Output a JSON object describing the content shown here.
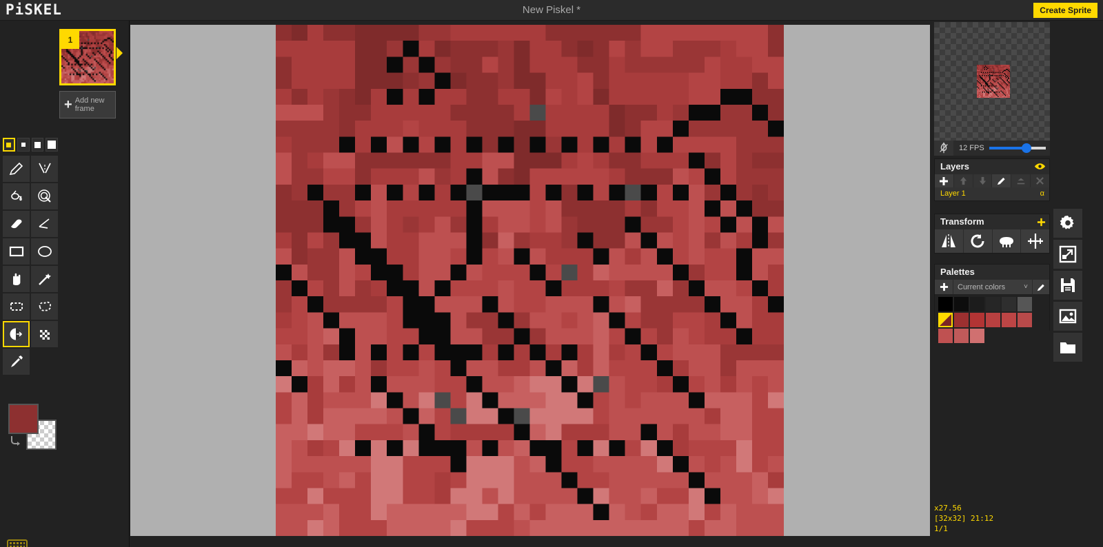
{
  "app": {
    "logo": "PiSKEL",
    "title": "New Piskel *",
    "create_sprite_label": "Create Sprite",
    "accent": "#ffd900",
    "bg": "#222222"
  },
  "frames": {
    "items": [
      {
        "number": "1",
        "selected": true
      }
    ],
    "add_frame_label_line1": "Add new",
    "add_frame_label_line2": "frame",
    "add_frame_plus": "+"
  },
  "pen_sizes": [
    {
      "name": "size-1",
      "selected": true
    },
    {
      "name": "size-2",
      "selected": false
    },
    {
      "name": "size-3",
      "selected": false
    },
    {
      "name": "size-4",
      "selected": false
    }
  ],
  "tools": [
    {
      "name": "pen-tool",
      "icon": "pencil-icon",
      "selected": false
    },
    {
      "name": "vertical-mirror-pen-tool",
      "icon": "mirror-pen-icon",
      "selected": false
    },
    {
      "name": "paint-bucket-tool",
      "icon": "paint-bucket-icon",
      "selected": false
    },
    {
      "name": "paint-all-similar-tool",
      "icon": "paint-all-icon",
      "selected": false
    },
    {
      "name": "eraser-tool",
      "icon": "eraser-icon",
      "selected": false
    },
    {
      "name": "stroke-tool",
      "icon": "stroke-icon",
      "selected": false
    },
    {
      "name": "rectangle-tool",
      "icon": "rectangle-icon",
      "selected": false
    },
    {
      "name": "circle-tool",
      "icon": "circle-icon",
      "selected": false
    },
    {
      "name": "move-tool",
      "icon": "hand-icon",
      "selected": false
    },
    {
      "name": "magic-wand-tool",
      "icon": "magic-wand-icon",
      "selected": false
    },
    {
      "name": "rectangle-select-tool",
      "icon": "rectangle-select-icon",
      "selected": false
    },
    {
      "name": "lasso-select-tool",
      "icon": "lasso-icon",
      "selected": false
    },
    {
      "name": "lighten-tool",
      "icon": "lighten-icon",
      "selected": true
    },
    {
      "name": "dithering-tool",
      "icon": "dither-icon",
      "selected": false
    },
    {
      "name": "color-picker-tool",
      "icon": "eyedropper-icon",
      "selected": false
    }
  ],
  "colors": {
    "primary": "#8d3030",
    "secondary": "transparent"
  },
  "preview": {
    "fps_label": "12 FPS",
    "fps_value": 12,
    "onion_skin": "onion-skin-icon"
  },
  "layers": {
    "title": "Layers",
    "tools": [
      {
        "name": "add-layer-button",
        "icon": "plus-icon",
        "enabled": true
      },
      {
        "name": "move-layer-up-button",
        "icon": "arrow-up-icon",
        "enabled": false
      },
      {
        "name": "move-layer-down-button",
        "icon": "arrow-down-icon",
        "enabled": false
      },
      {
        "name": "rename-layer-button",
        "icon": "pencil-icon",
        "enabled": true
      },
      {
        "name": "merge-layer-button",
        "icon": "merge-icon",
        "enabled": false
      },
      {
        "name": "delete-layer-button",
        "icon": "close-icon",
        "enabled": false
      }
    ],
    "items": [
      {
        "label": "Layer 1",
        "opacity_label": "α",
        "selected": true
      }
    ],
    "visibility_icon": "eye-icon"
  },
  "transform": {
    "title": "Transform",
    "expand_icon": "plus-icon",
    "tools": [
      {
        "name": "flip-horizontal-button",
        "icon": "flip-icon"
      },
      {
        "name": "rotate-button",
        "icon": "rotate-icon"
      },
      {
        "name": "clone-button",
        "icon": "sheep-icon"
      },
      {
        "name": "center-button",
        "icon": "crosshair-icon"
      }
    ]
  },
  "palettes": {
    "title": "Palettes",
    "add_icon": "plus-icon",
    "selected_palette": "Current colors",
    "chevron": "˅",
    "edit_icon": "pencil-icon",
    "swatches": [
      {
        "color": "#000000",
        "active": false
      },
      {
        "color": "#0d0d0d",
        "active": false
      },
      {
        "color": "#1c1c1c",
        "active": false
      },
      {
        "color": "#262626",
        "active": false
      },
      {
        "color": "#2e2e2e",
        "active": false
      },
      {
        "color": "#565656",
        "active": false
      },
      {
        "color": "#7a2626",
        "active": true
      },
      {
        "color": "#9c3030",
        "active": false
      },
      {
        "color": "#b33434",
        "active": false
      },
      {
        "color": "#b84040",
        "active": false
      },
      {
        "color": "#bd4545",
        "active": false
      },
      {
        "color": "#b84a4a",
        "active": false
      },
      {
        "color": "#bf5151",
        "active": false
      },
      {
        "color": "#c05a5a",
        "active": false
      },
      {
        "color": "#d07070",
        "active": false
      }
    ]
  },
  "right_icon_bar": [
    {
      "name": "settings-button",
      "icon": "gear-icon"
    },
    {
      "name": "resize-button",
      "icon": "resize-icon"
    },
    {
      "name": "save-button",
      "icon": "floppy-disk-icon"
    },
    {
      "name": "export-button",
      "icon": "image-icon"
    },
    {
      "name": "import-button",
      "icon": "folder-icon"
    }
  ],
  "status": {
    "zoom": "x27.56",
    "dimensions_and_cursor": "[32x32] 21:12",
    "frame_counter": "1/1"
  },
  "keyboard_shortcut_icon": "keyboard-icon",
  "sprite": {
    "width": 32,
    "height": 32,
    "description": "32x32 pixel art: mottled dark red background with scattered black pixel lines forming web-like strands",
    "base_palette": [
      "#7f2b2b",
      "#8d3030",
      "#9a3636",
      "#a83c3c",
      "#b34444",
      "#bd5050",
      "#c76060",
      "#d17878"
    ],
    "dark": "#0a0a0a"
  }
}
